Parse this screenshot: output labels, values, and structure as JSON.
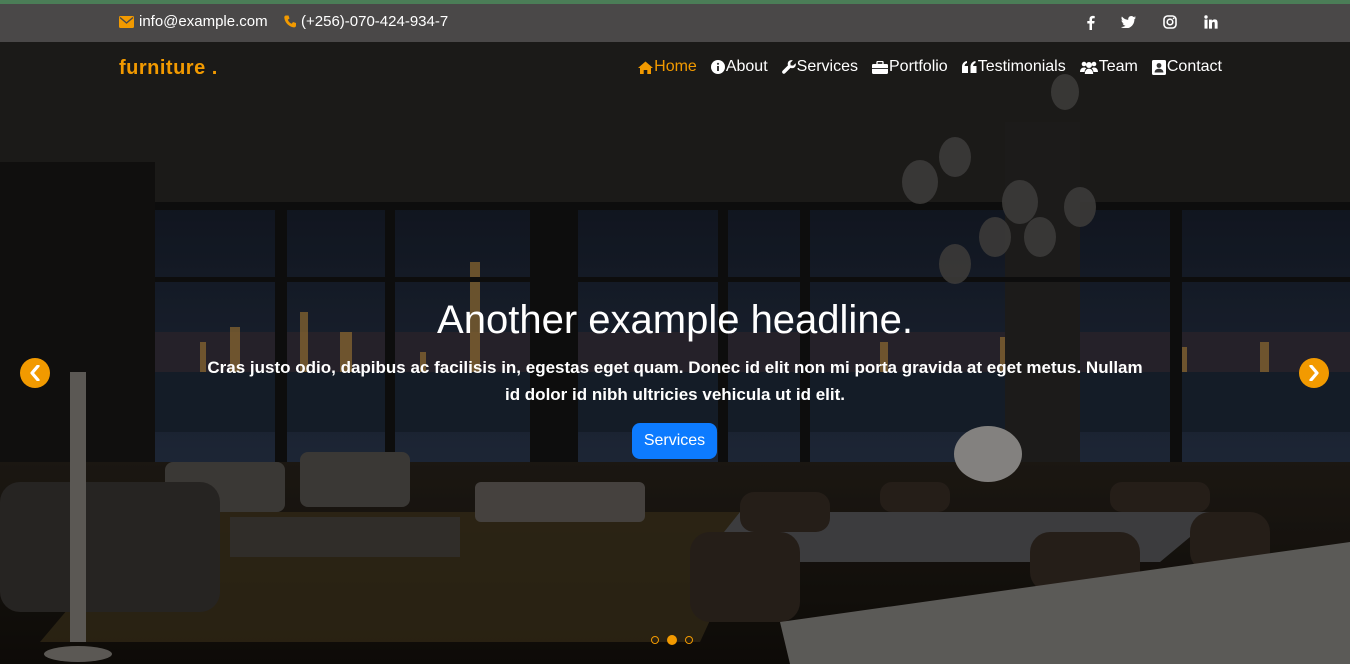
{
  "topbar": {
    "email": "info@example.com",
    "phone": "(+256)-070-424-934-7",
    "social_icons": [
      "facebook-icon",
      "twitter-icon",
      "instagram-icon",
      "linkedin-icon"
    ]
  },
  "brand": "furniture .",
  "nav": {
    "items": [
      {
        "label": "Home",
        "icon": "home-icon",
        "active": true
      },
      {
        "label": "About",
        "icon": "info-icon"
      },
      {
        "label": "Services",
        "icon": "wrench-icon"
      },
      {
        "label": "Portfolio",
        "icon": "briefcase-icon"
      },
      {
        "label": "Testimonials",
        "icon": "quote-icon"
      },
      {
        "label": "Team",
        "icon": "users-icon"
      },
      {
        "label": "Contact",
        "icon": "contact-card-icon"
      }
    ]
  },
  "hero": {
    "headline": "Another example headline.",
    "text": "Cras justo odio, dapibus ac facilisis in, egestas eget quam. Donec id elit non mi porta gravida at eget metus. Nullam id dolor id nibh ultricies vehicula ut id elit.",
    "button_label": "Services",
    "slide_count": 3,
    "active_slide": 2
  },
  "colors": {
    "accent": "#f29a00",
    "button": "#0d7bff",
    "topbar_bg": "#4a4848",
    "accent_line": "#4b7d57"
  }
}
